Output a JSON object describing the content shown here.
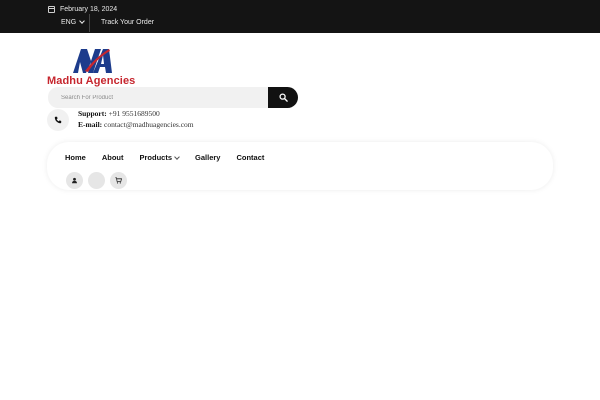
{
  "topbar": {
    "date": "February 18, 2024",
    "language": "ENG",
    "track_order": "Track Your Order",
    "icons": [
      "calendar-icon",
      "chevron-down-icon"
    ]
  },
  "logo": {
    "brand_name": "Madhu Agencies",
    "colors": {
      "primary": "#1d3c8c",
      "accent": "#c6262e"
    }
  },
  "search": {
    "placeholder": "Search For Product",
    "button_icon": "search-icon"
  },
  "support": {
    "support_label": "Support:",
    "phone": "+91 9551689500",
    "email_label": "E-mail:",
    "email": "contact@madhuagencies.com",
    "icon": "phone-icon"
  },
  "nav": {
    "items": [
      {
        "label": "Home"
      },
      {
        "label": "About"
      },
      {
        "label": "Products"
      },
      {
        "label": "Gallery"
      },
      {
        "label": "Contact"
      }
    ]
  },
  "header_icons": [
    "user-icon",
    "blank-icon",
    "cart-icon"
  ]
}
